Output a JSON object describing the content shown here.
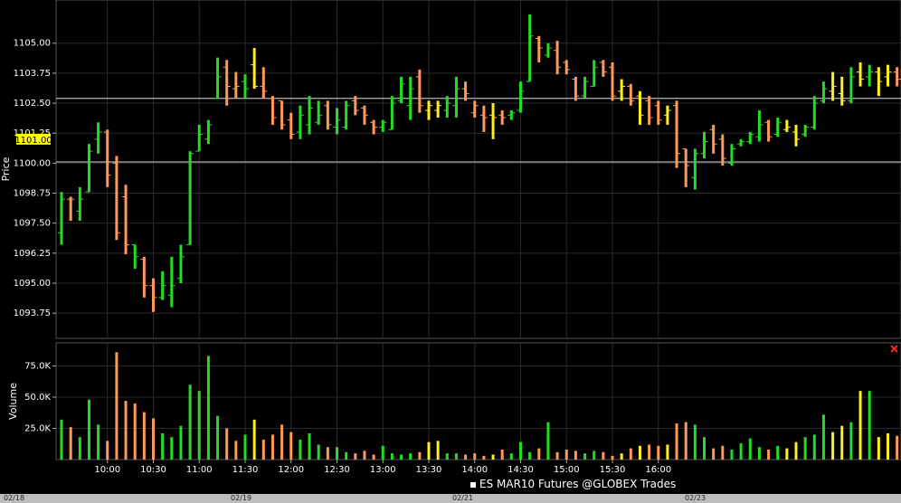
{
  "chart_data": [
    {
      "type": "bar",
      "subtype": "ohlc",
      "ylabel": "Price",
      "yticks": [
        "1105.00",
        "1103.75",
        "1102.50",
        "1101.25",
        "1100.00",
        "1098.75",
        "1097.50",
        "1096.25",
        "1095.00",
        "1093.75"
      ],
      "ylim": [
        1092.7,
        1106.8
      ],
      "current_price": 1101.0,
      "current_price_label": "1101.00",
      "reference_lines": [
        1102.7,
        1100.05
      ],
      "grid": true,
      "colors": {
        "up": "#22dd22",
        "down": "#ff9955",
        "neutral": "#ffee22",
        "grid": "#2a2a2a",
        "ref": "#dddddd",
        "badge": "#ffff00"
      },
      "bars": [
        {
          "h": 1098.8,
          "l": 1096.6,
          "o": 1097.1,
          "c": 1098.5,
          "s": "up"
        },
        {
          "h": 1098.6,
          "l": 1097.6,
          "o": 1098.5,
          "c": 1098.5,
          "s": "down"
        },
        {
          "h": 1099.0,
          "l": 1097.6,
          "o": 1098.0,
          "c": 1098.5,
          "s": "up"
        },
        {
          "h": 1100.8,
          "l": 1098.8,
          "o": 1098.8,
          "c": 1100.5,
          "s": "up"
        },
        {
          "h": 1101.7,
          "l": 1100.4,
          "o": 1101.0,
          "c": 1101.3,
          "s": "up"
        },
        {
          "h": 1101.4,
          "l": 1099.0,
          "o": 1101.3,
          "c": 1099.5,
          "s": "down"
        },
        {
          "h": 1100.3,
          "l": 1096.8,
          "o": 1100.0,
          "c": 1097.1,
          "s": "down"
        },
        {
          "h": 1099.1,
          "l": 1096.2,
          "o": 1098.6,
          "c": 1096.6,
          "s": "down"
        },
        {
          "h": 1096.6,
          "l": 1095.6,
          "o": 1096.6,
          "c": 1096.1,
          "s": "up"
        },
        {
          "h": 1096.1,
          "l": 1094.4,
          "o": 1096.0,
          "c": 1094.9,
          "s": "down"
        },
        {
          "h": 1095.2,
          "l": 1093.8,
          "o": 1094.9,
          "c": 1094.4,
          "s": "down"
        },
        {
          "h": 1095.5,
          "l": 1094.3,
          "o": 1094.4,
          "c": 1094.9,
          "s": "up"
        },
        {
          "h": 1096.1,
          "l": 1094.0,
          "o": 1094.5,
          "c": 1094.9,
          "s": "up"
        },
        {
          "h": 1096.6,
          "l": 1095.0,
          "o": 1095.2,
          "c": 1096.1,
          "s": "up"
        },
        {
          "h": 1100.5,
          "l": 1096.6,
          "o": 1096.6,
          "c": 1100.4,
          "s": "up"
        },
        {
          "h": 1101.6,
          "l": 1100.5,
          "o": 1100.5,
          "c": 1101.2,
          "s": "up"
        },
        {
          "h": 1101.8,
          "l": 1100.8,
          "o": 1101.0,
          "c": 1101.6,
          "s": "up"
        },
        {
          "h": 1104.4,
          "l": 1102.7,
          "o": 1102.7,
          "c": 1103.6,
          "s": "up"
        },
        {
          "h": 1104.3,
          "l": 1102.4,
          "o": 1104.0,
          "c": 1103.2,
          "s": "down"
        },
        {
          "h": 1103.8,
          "l": 1102.7,
          "o": 1103.1,
          "c": 1103.2,
          "s": "down"
        },
        {
          "h": 1103.7,
          "l": 1102.7,
          "o": 1103.4,
          "c": 1103.1,
          "s": "up"
        },
        {
          "h": 1104.8,
          "l": 1103.1,
          "o": 1104.1,
          "c": 1103.2,
          "s": "neutral"
        },
        {
          "h": 1104.0,
          "l": 1102.7,
          "o": 1103.2,
          "c": 1103.0,
          "s": "down"
        },
        {
          "h": 1102.8,
          "l": 1101.6,
          "o": 1102.7,
          "c": 1101.9,
          "s": "down"
        },
        {
          "h": 1102.6,
          "l": 1101.4,
          "o": 1102.6,
          "c": 1101.6,
          "s": "down"
        },
        {
          "h": 1102.1,
          "l": 1101.0,
          "o": 1101.8,
          "c": 1101.2,
          "s": "down"
        },
        {
          "h": 1102.4,
          "l": 1101.0,
          "o": 1101.3,
          "c": 1102.0,
          "s": "up"
        },
        {
          "h": 1102.8,
          "l": 1101.2,
          "o": 1101.6,
          "c": 1102.3,
          "s": "up"
        },
        {
          "h": 1102.6,
          "l": 1101.6,
          "o": 1101.7,
          "c": 1102.0,
          "s": "up"
        },
        {
          "h": 1102.6,
          "l": 1101.4,
          "o": 1102.4,
          "c": 1101.6,
          "s": "down"
        },
        {
          "h": 1102.3,
          "l": 1101.2,
          "o": 1101.5,
          "c": 1101.8,
          "s": "up"
        },
        {
          "h": 1102.6,
          "l": 1101.4,
          "o": 1101.5,
          "c": 1102.4,
          "s": "up"
        },
        {
          "h": 1102.8,
          "l": 1102.0,
          "o": 1102.6,
          "c": 1102.2,
          "s": "down"
        },
        {
          "h": 1102.4,
          "l": 1101.6,
          "o": 1102.3,
          "c": 1102.0,
          "s": "down"
        },
        {
          "h": 1101.8,
          "l": 1101.2,
          "o": 1101.7,
          "c": 1101.5,
          "s": "down"
        },
        {
          "h": 1101.8,
          "l": 1101.3,
          "o": 1101.5,
          "c": 1101.7,
          "s": "up"
        },
        {
          "h": 1102.8,
          "l": 1101.4,
          "o": 1101.4,
          "c": 1102.5,
          "s": "up"
        },
        {
          "h": 1103.6,
          "l": 1102.5,
          "o": 1102.6,
          "c": 1103.3,
          "s": "up"
        },
        {
          "h": 1103.6,
          "l": 1101.8,
          "o": 1102.4,
          "c": 1103.1,
          "s": "up"
        },
        {
          "h": 1103.9,
          "l": 1102.1,
          "o": 1103.6,
          "c": 1102.4,
          "s": "down"
        },
        {
          "h": 1102.6,
          "l": 1101.8,
          "o": 1102.2,
          "c": 1102.4,
          "s": "neutral"
        },
        {
          "h": 1102.6,
          "l": 1101.9,
          "o": 1102.2,
          "c": 1102.4,
          "s": "neutral"
        },
        {
          "h": 1102.8,
          "l": 1101.9,
          "o": 1102.2,
          "c": 1102.5,
          "s": "up"
        },
        {
          "h": 1103.6,
          "l": 1101.9,
          "o": 1102.4,
          "c": 1103.1,
          "s": "up"
        },
        {
          "h": 1103.4,
          "l": 1102.6,
          "o": 1103.1,
          "c": 1102.9,
          "s": "down"
        },
        {
          "h": 1102.6,
          "l": 1101.9,
          "o": 1102.1,
          "c": 1102.4,
          "s": "down"
        },
        {
          "h": 1102.4,
          "l": 1101.3,
          "o": 1102.0,
          "c": 1101.9,
          "s": "down"
        },
        {
          "h": 1102.5,
          "l": 1101.0,
          "o": 1102.0,
          "c": 1101.9,
          "s": "neutral"
        },
        {
          "h": 1102.2,
          "l": 1101.6,
          "o": 1102.0,
          "c": 1101.9,
          "s": "down"
        },
        {
          "h": 1102.2,
          "l": 1101.8,
          "o": 1102.0,
          "c": 1102.1,
          "s": "up"
        },
        {
          "h": 1103.4,
          "l": 1102.1,
          "o": 1102.2,
          "c": 1103.0,
          "s": "up"
        },
        {
          "h": 1106.2,
          "l": 1103.4,
          "o": 1103.4,
          "c": 1105.3,
          "s": "up"
        },
        {
          "h": 1105.3,
          "l": 1104.2,
          "o": 1105.2,
          "c": 1104.8,
          "s": "down"
        },
        {
          "h": 1105.0,
          "l": 1104.4,
          "o": 1104.5,
          "c": 1104.8,
          "s": "up"
        },
        {
          "h": 1105.1,
          "l": 1103.7,
          "o": 1104.7,
          "c": 1104.0,
          "s": "down"
        },
        {
          "h": 1104.3,
          "l": 1103.7,
          "o": 1104.2,
          "c": 1103.9,
          "s": "down"
        },
        {
          "h": 1103.6,
          "l": 1102.6,
          "o": 1103.5,
          "c": 1102.8,
          "s": "down"
        },
        {
          "h": 1103.6,
          "l": 1102.7,
          "o": 1102.8,
          "c": 1103.4,
          "s": "up"
        },
        {
          "h": 1104.3,
          "l": 1103.2,
          "o": 1103.2,
          "c": 1104.0,
          "s": "up"
        },
        {
          "h": 1104.3,
          "l": 1103.6,
          "o": 1104.2,
          "c": 1103.8,
          "s": "down"
        },
        {
          "h": 1104.2,
          "l": 1102.6,
          "o": 1104.0,
          "c": 1102.8,
          "s": "down"
        },
        {
          "h": 1103.5,
          "l": 1102.6,
          "o": 1103.0,
          "c": 1103.2,
          "s": "neutral"
        },
        {
          "h": 1103.3,
          "l": 1102.4,
          "o": 1103.2,
          "c": 1102.6,
          "s": "down"
        },
        {
          "h": 1103.0,
          "l": 1101.6,
          "o": 1102.8,
          "c": 1102.0,
          "s": "neutral"
        },
        {
          "h": 1102.8,
          "l": 1101.6,
          "o": 1102.6,
          "c": 1101.9,
          "s": "down"
        },
        {
          "h": 1102.6,
          "l": 1101.6,
          "o": 1102.4,
          "c": 1101.8,
          "s": "down"
        },
        {
          "h": 1102.4,
          "l": 1101.6,
          "o": 1102.0,
          "c": 1102.2,
          "s": "neutral"
        },
        {
          "h": 1102.6,
          "l": 1099.8,
          "o": 1102.4,
          "c": 1100.4,
          "s": "down"
        },
        {
          "h": 1100.6,
          "l": 1099.0,
          "o": 1100.6,
          "c": 1099.9,
          "s": "down"
        },
        {
          "h": 1100.6,
          "l": 1098.9,
          "o": 1099.4,
          "c": 1100.4,
          "s": "up"
        },
        {
          "h": 1101.3,
          "l": 1100.2,
          "o": 1100.4,
          "c": 1100.9,
          "s": "up"
        },
        {
          "h": 1101.6,
          "l": 1100.4,
          "o": 1101.4,
          "c": 1100.8,
          "s": "down"
        },
        {
          "h": 1101.2,
          "l": 1099.9,
          "o": 1101.0,
          "c": 1100.2,
          "s": "down"
        },
        {
          "h": 1100.8,
          "l": 1099.9,
          "o": 1100.0,
          "c": 1100.6,
          "s": "up"
        },
        {
          "h": 1101.0,
          "l": 1100.7,
          "o": 1100.8,
          "c": 1100.9,
          "s": "up"
        },
        {
          "h": 1101.3,
          "l": 1100.8,
          "o": 1100.9,
          "c": 1101.2,
          "s": "up"
        },
        {
          "h": 1102.2,
          "l": 1100.9,
          "o": 1101.1,
          "c": 1101.6,
          "s": "up"
        },
        {
          "h": 1101.8,
          "l": 1100.9,
          "o": 1101.7,
          "c": 1101.1,
          "s": "down"
        },
        {
          "h": 1101.9,
          "l": 1101.1,
          "o": 1101.2,
          "c": 1101.7,
          "s": "up"
        },
        {
          "h": 1101.8,
          "l": 1101.3,
          "o": 1101.4,
          "c": 1101.5,
          "s": "neutral"
        },
        {
          "h": 1101.6,
          "l": 1100.7,
          "o": 1101.3,
          "c": 1101.0,
          "s": "neutral"
        },
        {
          "h": 1101.6,
          "l": 1101.1,
          "o": 1101.2,
          "c": 1101.5,
          "s": "up"
        },
        {
          "h": 1102.8,
          "l": 1101.4,
          "o": 1101.5,
          "c": 1102.5,
          "s": "up"
        },
        {
          "h": 1103.4,
          "l": 1102.5,
          "o": 1102.6,
          "c": 1103.1,
          "s": "up"
        },
        {
          "h": 1103.8,
          "l": 1102.6,
          "o": 1103.0,
          "c": 1103.2,
          "s": "neutral"
        },
        {
          "h": 1103.6,
          "l": 1102.4,
          "o": 1102.9,
          "c": 1102.6,
          "s": "neutral"
        },
        {
          "h": 1104.0,
          "l": 1102.5,
          "o": 1102.6,
          "c": 1103.6,
          "s": "up"
        },
        {
          "h": 1104.2,
          "l": 1103.2,
          "o": 1103.8,
          "c": 1103.5,
          "s": "neutral"
        },
        {
          "h": 1104.1,
          "l": 1103.2,
          "o": 1103.6,
          "c": 1103.8,
          "s": "up"
        },
        {
          "h": 1104.0,
          "l": 1102.8,
          "o": 1103.8,
          "c": 1103.4,
          "s": "neutral"
        },
        {
          "h": 1104.1,
          "l": 1103.2,
          "o": 1103.6,
          "c": 1103.8,
          "s": "neutral"
        },
        {
          "h": 1104.0,
          "l": 1103.2,
          "o": 1103.8,
          "c": 1103.5,
          "s": "down"
        }
      ]
    },
    {
      "type": "bar",
      "ylabel": "Volume",
      "yticks": [
        "75.0K",
        "50.0K",
        "25.0K"
      ],
      "ylim": [
        0,
        93500
      ],
      "grid": true,
      "values": [
        32000,
        26000,
        18000,
        48000,
        28000,
        15000,
        86000,
        47000,
        45000,
        38000,
        33000,
        21000,
        18000,
        27000,
        60000,
        55000,
        83000,
        35000,
        25000,
        15000,
        20000,
        32000,
        16000,
        20000,
        28000,
        22000,
        16000,
        21000,
        12000,
        10000,
        10000,
        6000,
        5000,
        7000,
        4000,
        11000,
        5000,
        4000,
        5000,
        6000,
        14000,
        15000,
        5000,
        5000,
        4000,
        5000,
        3000,
        4000,
        8000,
        5000,
        14000,
        6000,
        9000,
        30000,
        6000,
        8000,
        7000,
        5000,
        7000,
        6000,
        3000,
        5000,
        9000,
        11000,
        12000,
        11000,
        12000,
        29000,
        30000,
        28000,
        18000,
        9000,
        11000,
        8000,
        13000,
        17000,
        10000,
        8000,
        11000,
        9000,
        14000,
        18000,
        20000,
        36000,
        22000,
        27000,
        30000,
        55000,
        55000,
        18000,
        21000,
        19000
      ],
      "sides": [
        "up",
        "down",
        "up",
        "up",
        "up",
        "down",
        "down",
        "down",
        "down",
        "down",
        "down",
        "up",
        "up",
        "up",
        "up",
        "up",
        "up",
        "up",
        "down",
        "down",
        "up",
        "neutral",
        "down",
        "down",
        "down",
        "down",
        "up",
        "up",
        "up",
        "down",
        "up",
        "up",
        "down",
        "down",
        "down",
        "up",
        "up",
        "up",
        "up",
        "down",
        "neutral",
        "neutral",
        "up",
        "up",
        "down",
        "down",
        "down",
        "neutral",
        "down",
        "up",
        "up",
        "up",
        "down",
        "up",
        "down",
        "down",
        "down",
        "up",
        "up",
        "down",
        "down",
        "neutral",
        "down",
        "neutral",
        "down",
        "down",
        "neutral",
        "down",
        "down",
        "up",
        "up",
        "down",
        "down",
        "up",
        "up",
        "up",
        "up",
        "down",
        "up",
        "neutral",
        "neutral",
        "up",
        "up",
        "up",
        "neutral",
        "neutral",
        "up",
        "neutral",
        "up",
        "neutral",
        "neutral",
        "down"
      ],
      "x_ticks": [
        "10:00",
        "10:30",
        "11:00",
        "11:30",
        "12:00",
        "12:30",
        "13:00",
        "13:30",
        "14:00",
        "14:30",
        "15:00",
        "15:30",
        "16:00"
      ],
      "x_tick_bar_index": [
        5,
        10,
        15,
        20,
        25,
        30,
        35,
        40,
        45,
        50,
        55,
        60,
        65
      ],
      "legend": "ES MAR10 Futures @GLOBEX Trades",
      "dates": [
        "02/18",
        "02/19",
        "02/21",
        "02/23"
      ],
      "close_icon": "close-x-icon"
    }
  ]
}
